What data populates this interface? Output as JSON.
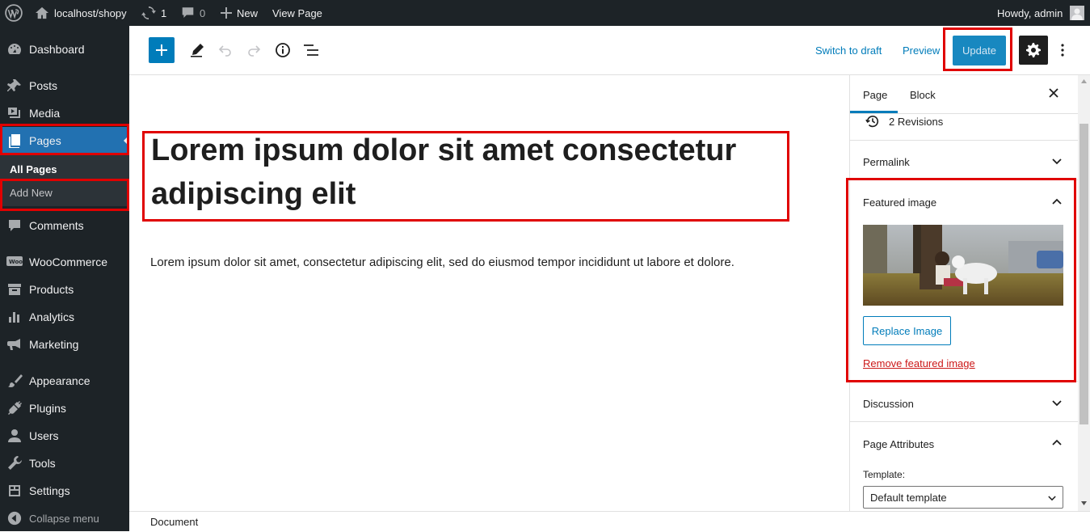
{
  "adminbar": {
    "site_name": "localhost/shopy",
    "updates_count": "1",
    "comments_count": "0",
    "new_label": "New",
    "view_page_label": "View Page",
    "howdy": "Howdy, admin"
  },
  "sidebar": {
    "items": [
      {
        "label": "Dashboard",
        "icon": "dashboard-icon"
      },
      {
        "label": "Posts",
        "icon": "pin-icon"
      },
      {
        "label": "Media",
        "icon": "media-icon"
      },
      {
        "label": "Pages",
        "icon": "pages-icon"
      },
      {
        "label": "Comments",
        "icon": "comment-icon"
      },
      {
        "label": "WooCommerce",
        "icon": "woo-icon"
      },
      {
        "label": "Products",
        "icon": "archive-icon"
      },
      {
        "label": "Analytics",
        "icon": "chart-icon"
      },
      {
        "label": "Marketing",
        "icon": "megaphone-icon"
      },
      {
        "label": "Appearance",
        "icon": "brush-icon"
      },
      {
        "label": "Plugins",
        "icon": "plugin-icon"
      },
      {
        "label": "Users",
        "icon": "user-icon"
      },
      {
        "label": "Tools",
        "icon": "wrench-icon"
      },
      {
        "label": "Settings",
        "icon": "settings-icon"
      },
      {
        "label": "Collapse menu",
        "icon": "collapse-icon"
      }
    ],
    "submenu": {
      "all_pages": "All Pages",
      "add_new": "Add New"
    }
  },
  "toolbar": {
    "switch_to_draft": "Switch to draft",
    "preview": "Preview",
    "update": "Update"
  },
  "editor": {
    "title": "Lorem ipsum dolor sit amet consectetur adipiscing elit",
    "paragraph": "Lorem ipsum dolor sit amet, consectetur adipiscing elit, sed do eiusmod tempor incididunt ut labore et dolore."
  },
  "panel": {
    "tab_page": "Page",
    "tab_block": "Block",
    "revisions": "2 Revisions",
    "permalink": "Permalink",
    "featured_image": "Featured image",
    "replace_image": "Replace Image",
    "remove_featured": "Remove featured image",
    "discussion": "Discussion",
    "page_attributes": "Page Attributes",
    "template_label": "Template:",
    "template_value": "Default template"
  },
  "footer": {
    "breadcrumb": "Document"
  },
  "colors": {
    "accent": "#007cba",
    "highlight": "#e00000",
    "admin_bg": "#1d2327"
  }
}
